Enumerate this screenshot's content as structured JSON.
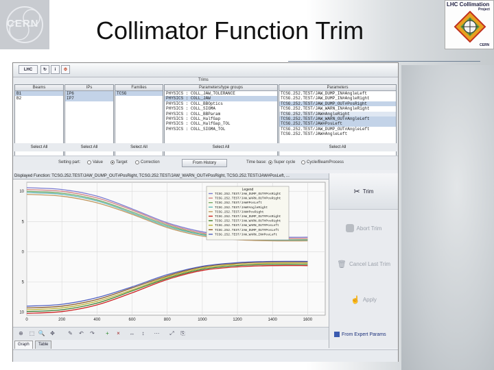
{
  "slide": {
    "title": "Collimator Function Trim",
    "logo_left_text": "CERN",
    "logo_right_title": "LHC Collimation",
    "logo_right_sub": "Project",
    "logo_right_cern": "CERN"
  },
  "app": {
    "toolbar": {
      "lhc_label": "LHC"
    },
    "selector": {
      "panel_title": "Trims",
      "columns": [
        {
          "header": "Beams",
          "rows": [
            "B1",
            "B2"
          ]
        },
        {
          "header": "IPs",
          "rows": [
            "IP6",
            "IP7"
          ]
        },
        {
          "header": "Families",
          "rows": [
            "TCSG"
          ]
        },
        {
          "header": "Parameters/type groups",
          "rows": [
            "PHYSICS : COLL_JAW_TOLERANCE",
            "PHYSICS : COLL_JAW",
            "PHYSICS : COLL_BBOptics",
            "PHYSICS : COLL_SIGMA",
            "PHYSICS : COLL_BBParam",
            "PHYSICS : COLL_HalfGap",
            "PHYSICS : COLL_HalfGap_TOL",
            "PHYSICS : COLL_SIGMA_TOL"
          ]
        },
        {
          "header": "Parameters",
          "rows": [
            "TCSG.252.TEST/JAW_DUMP_IN#AngleLeft",
            "TCSG.252.TEST/JAW_DUMP_IN#AngleRight",
            "TCSG.252.TEST/JAW_DUMP_OUT#PosRight",
            "TCSG.252.TEST/JAW_WARN_IN#AngleRight",
            "TCSG.252.TEST/JAW#AngleRight",
            "TCSG.252.TEST/JAW_WARN_OUT#AngleLeft",
            "TCSG.252.TEST/JAW#PosLeft",
            "TCSG.252.TEST/JAW_DUMP_OUT#AngleLeft",
            "TCSG.252.TEST/JAW#AngleLeft"
          ]
        }
      ],
      "select_all_label": "Select All"
    },
    "settings": {
      "setting_part_label": "Setting part:",
      "options": [
        "Value",
        "Target",
        "Correction"
      ],
      "selected": "Target",
      "from_history_label": "From History",
      "time_base_label": "Time base:",
      "time_options": [
        "Super cycle",
        "Cycle/BeamProcess"
      ],
      "time_selected": "Super cycle"
    },
    "displayed_function": "Displayed Function: TCSG.252.TEST/JAW_DUMP_OUT#PosRight, TCSG.252.TEST/JAW_WARN_OUT#PosRight, TCSG.252.TEST/JAW#PosLeft, ...",
    "side_buttons": {
      "trim": "Trim",
      "abort": "Abort Trim",
      "cancel": "Cancel Last Trim",
      "apply": "Apply"
    },
    "from_expert_label": "From Expert Params",
    "tabs": [
      "Graph",
      "Table"
    ],
    "active_tab": "Graph"
  },
  "chart_data": {
    "type": "line",
    "title": "",
    "xlabel": "",
    "ylabel": "",
    "xlim": [
      0,
      1700
    ],
    "ylim": [
      -10.5,
      11.5
    ],
    "x_ticks": [
      0,
      200,
      400,
      600,
      800,
      1000,
      1200,
      1400,
      1600
    ],
    "y_ticks": [
      10,
      5,
      0,
      -5,
      -10
    ],
    "y_tick_labels": [
      "10",
      "5",
      "0",
      "5",
      "10"
    ],
    "grid": true,
    "legend": {
      "title": "Legend",
      "placement": "top-right",
      "entries": [
        "TCSG.252.TEST/JAW_DUMP_OUT#PosRight",
        "TCSG.252.TEST/JAW_WARN_OUT#PosRight",
        "TCSG.252.TEST/JAW#PosLeft",
        "TCSG.252.TEST/JAW#AngleRight",
        "TCSG.252.TEST/JAW#PosRight",
        "TCSG.252.TEST/JAW_DUMP_OUT#PosRight",
        "TCSG.252.TEST/JAW_WARN_OUT#PosRight",
        "TCSG.252.TEST/JAW_WARN_OUT#PosLeft",
        "TCSG.252.TEST/JAW_DUMP_OUT#PosLeft",
        "TCSG.252.TEST/JAW_WARN_IN#PosLeft"
      ]
    },
    "series": [
      {
        "color": "#7a7ad0",
        "x": [
          0,
          200,
          400,
          600,
          800,
          1000,
          1200,
          1400,
          1600
        ],
        "y": [
          10.6,
          10.3,
          9.2,
          7.1,
          4.8,
          3.3,
          2.6,
          2.4,
          2.4
        ]
      },
      {
        "color": "#d08080",
        "x": [
          0,
          200,
          400,
          600,
          800,
          1000,
          1200,
          1400,
          1600
        ],
        "y": [
          10.3,
          10.0,
          8.9,
          6.9,
          4.6,
          3.1,
          2.5,
          2.2,
          2.2
        ]
      },
      {
        "color": "#77aa66",
        "x": [
          0,
          200,
          400,
          600,
          800,
          1000,
          1200,
          1400,
          1600
        ],
        "y": [
          10.0,
          9.7,
          8.6,
          6.6,
          4.4,
          2.9,
          2.3,
          2.0,
          2.0
        ]
      },
      {
        "color": "#60b8b8",
        "x": [
          0,
          200,
          400,
          600,
          800,
          1000,
          1200,
          1400,
          1600
        ],
        "y": [
          9.8,
          9.5,
          8.4,
          6.4,
          4.2,
          2.8,
          2.1,
          1.9,
          1.9
        ]
      },
      {
        "color": "#c09860",
        "x": [
          0,
          200,
          400,
          600,
          800,
          1000,
          1200,
          1400,
          1600
        ],
        "y": [
          9.5,
          9.2,
          8.1,
          6.2,
          4.0,
          2.6,
          2.0,
          1.8,
          1.8
        ]
      },
      {
        "color": "#cc2222",
        "x": [
          0,
          200,
          400,
          600,
          800,
          1000,
          1200,
          1400,
          1600
        ],
        "y": [
          -10.2,
          -9.9,
          -8.8,
          -6.8,
          -4.6,
          -3.1,
          -2.5,
          -2.3,
          -2.3
        ]
      },
      {
        "color": "#3a7a2a",
        "x": [
          0,
          200,
          400,
          600,
          800,
          1000,
          1200,
          1400,
          1600
        ],
        "y": [
          -9.9,
          -9.6,
          -8.5,
          -6.5,
          -4.4,
          -2.9,
          -2.3,
          -2.1,
          -2.1
        ]
      },
      {
        "color": "#b8b030",
        "x": [
          0,
          200,
          400,
          600,
          800,
          1000,
          1200,
          1400,
          1600
        ],
        "y": [
          -9.6,
          -9.3,
          -8.2,
          -6.3,
          -4.2,
          -2.7,
          -2.1,
          -1.9,
          -1.9
        ]
      },
      {
        "color": "#8a5a2a",
        "x": [
          0,
          200,
          400,
          600,
          800,
          1000,
          1200,
          1400,
          1600
        ],
        "y": [
          -9.3,
          -9.0,
          -7.9,
          -6.0,
          -4.0,
          -2.5,
          -1.9,
          -1.7,
          -1.7
        ]
      },
      {
        "color": "#5060c0",
        "x": [
          0,
          200,
          400,
          600,
          800,
          1000,
          1200,
          1400,
          1600
        ],
        "y": [
          -9.0,
          -8.7,
          -7.6,
          -5.8,
          -3.8,
          -2.4,
          -1.8,
          -1.6,
          -1.6
        ]
      }
    ]
  }
}
